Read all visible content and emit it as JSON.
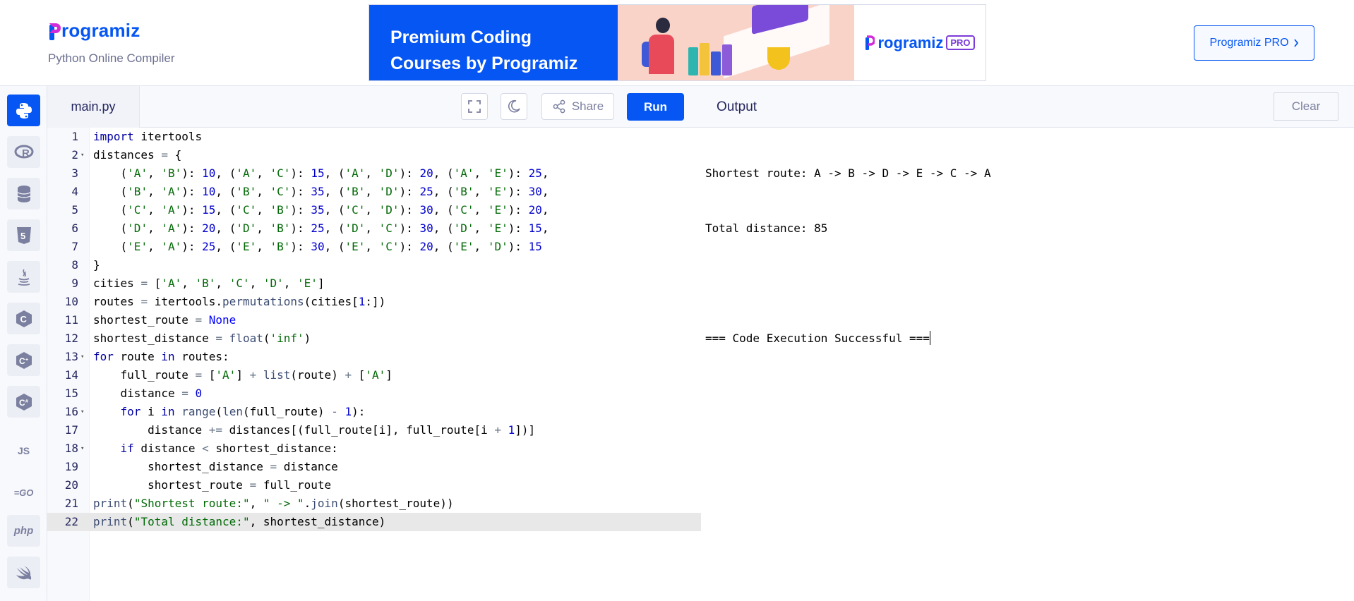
{
  "header": {
    "logo_text": "rogramiz",
    "subtitle": "Python Online Compiler",
    "banner": {
      "line1": "Premium Coding",
      "line2": "Courses by Programiz",
      "brand": "rogramiz",
      "badge": "PRO"
    },
    "pro_button_label": "Programiz PRO",
    "pro_button_icon": "chevron-right-icon"
  },
  "sidebar": {
    "languages": [
      {
        "name": "python-icon",
        "glyph": "🐍"
      },
      {
        "name": "r-icon",
        "glyph": "R"
      },
      {
        "name": "sql-icon",
        "glyph": "≣"
      },
      {
        "name": "html5-icon",
        "glyph": "5"
      },
      {
        "name": "java-icon",
        "glyph": "☕"
      },
      {
        "name": "c-icon",
        "glyph": "C"
      },
      {
        "name": "cplusplus-icon",
        "glyph": "C+"
      },
      {
        "name": "csharp-icon",
        "glyph": "C#"
      },
      {
        "name": "javascript-icon",
        "glyph": "JS"
      },
      {
        "name": "go-icon",
        "glyph": "GO"
      },
      {
        "name": "php-icon",
        "glyph": "php"
      },
      {
        "name": "swift-icon",
        "glyph": "➶"
      }
    ]
  },
  "editor": {
    "file_tab": "main.py",
    "share_label": "Share",
    "run_label": "Run",
    "lines": [
      {
        "n": "1"
      },
      {
        "n": "2"
      },
      {
        "n": "3"
      },
      {
        "n": "4"
      },
      {
        "n": "5"
      },
      {
        "n": "6"
      },
      {
        "n": "7"
      },
      {
        "n": "8"
      },
      {
        "n": "9"
      },
      {
        "n": "10"
      },
      {
        "n": "11"
      },
      {
        "n": "12"
      },
      {
        "n": "13"
      },
      {
        "n": "14"
      },
      {
        "n": "15"
      },
      {
        "n": "16"
      },
      {
        "n": "17"
      },
      {
        "n": "18"
      },
      {
        "n": "19"
      },
      {
        "n": "20"
      },
      {
        "n": "21"
      },
      {
        "n": "22"
      }
    ],
    "code": [
      "import itertools",
      "distances = {",
      "    ('A', 'B'): 10, ('A', 'C'): 15, ('A', 'D'): 20, ('A', 'E'): 25,",
      "    ('B', 'A'): 10, ('B', 'C'): 35, ('B', 'D'): 25, ('B', 'E'): 30,",
      "    ('C', 'A'): 15, ('C', 'B'): 35, ('C', 'D'): 30, ('C', 'E'): 20,",
      "    ('D', 'A'): 20, ('D', 'B'): 25, ('D', 'C'): 30, ('D', 'E'): 15,",
      "    ('E', 'A'): 25, ('E', 'B'): 30, ('E', 'C'): 20, ('E', 'D'): 15",
      "}",
      "cities = ['A', 'B', 'C', 'D', 'E']",
      "routes = itertools.permutations(cities[1:])",
      "shortest_route = None",
      "shortest_distance = float('inf')",
      "for route in routes:",
      "    full_route = ['A'] + list(route) + ['A']",
      "    distance = 0",
      "    for i in range(len(full_route) - 1):",
      "        distance += distances[(full_route[i], full_route[i + 1])]",
      "    if distance < shortest_distance:",
      "        shortest_distance = distance",
      "        shortest_route = full_route",
      "print(\"Shortest route:\", \" -> \".join(shortest_route))",
      "print(\"Total distance:\", shortest_distance)"
    ]
  },
  "output": {
    "title": "Output",
    "clear_label": "Clear",
    "lines": [
      "Shortest route: A -> B -> D -> E -> C -> A",
      "Total distance: 85",
      "",
      "=== Code Execution Successful ==="
    ]
  },
  "colors": {
    "accent": "#0556f3",
    "keyword": "#0000ff",
    "string": "#036a07",
    "number": "#0000cd"
  }
}
